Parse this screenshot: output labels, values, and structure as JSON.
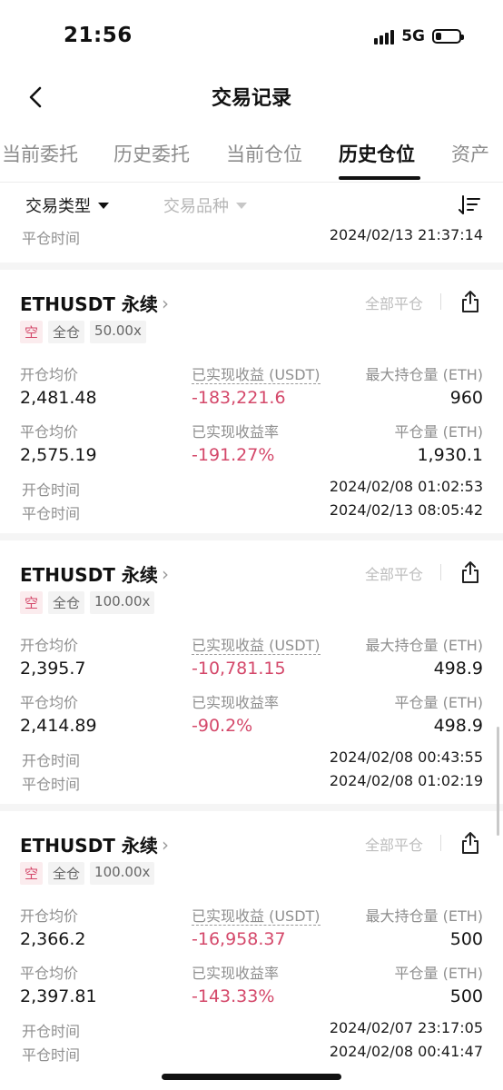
{
  "status": {
    "time": "21:56",
    "network": "5G"
  },
  "nav": {
    "title": "交易记录"
  },
  "tabs": [
    {
      "label": "当前委托"
    },
    {
      "label": "历史委托"
    },
    {
      "label": "当前仓位"
    },
    {
      "label": "历史仓位"
    },
    {
      "label": "资产"
    }
  ],
  "filters": {
    "trade_type": "交易类型",
    "trade_symbol": "交易品种"
  },
  "top_partial": {
    "close_time_label": "平仓时间",
    "close_time": "2024/02/13 21:37:14"
  },
  "cards": [
    {
      "symbol": "ETHUSDT 永续",
      "close_all": "全部平仓",
      "side": "空",
      "margin": "全仓",
      "leverage": "50.00x",
      "open_avg_label": "开仓均价",
      "open_avg": "2,481.48",
      "pnl_label": "已实现收益 (USDT)",
      "pnl": "-183,221.6",
      "max_pos_label": "最大持仓量 (ETH)",
      "max_pos": "960",
      "close_avg_label": "平仓均价",
      "close_avg": "2,575.19",
      "pnl_rate_label": "已实现收益率",
      "pnl_rate": "-191.27%",
      "close_qty_label": "平仓量 (ETH)",
      "close_qty": "1,930.1",
      "open_time_label": "开仓时间",
      "open_time": "2024/02/08 01:02:53",
      "close_time_label": "平仓时间",
      "close_time": "2024/02/13 08:05:42"
    },
    {
      "symbol": "ETHUSDT 永续",
      "close_all": "全部平仓",
      "side": "空",
      "margin": "全仓",
      "leverage": "100.00x",
      "open_avg_label": "开仓均价",
      "open_avg": "2,395.7",
      "pnl_label": "已实现收益 (USDT)",
      "pnl": "-10,781.15",
      "max_pos_label": "最大持仓量 (ETH)",
      "max_pos": "498.9",
      "close_avg_label": "平仓均价",
      "close_avg": "2,414.89",
      "pnl_rate_label": "已实现收益率",
      "pnl_rate": "-90.2%",
      "close_qty_label": "平仓量 (ETH)",
      "close_qty": "498.9",
      "open_time_label": "开仓时间",
      "open_time": "2024/02/08 00:43:55",
      "close_time_label": "平仓时间",
      "close_time": "2024/02/08 01:02:19"
    },
    {
      "symbol": "ETHUSDT 永续",
      "close_all": "全部平仓",
      "side": "空",
      "margin": "全仓",
      "leverage": "100.00x",
      "open_avg_label": "开仓均价",
      "open_avg": "2,366.2",
      "pnl_label": "已实现收益 (USDT)",
      "pnl": "-16,958.37",
      "max_pos_label": "最大持仓量 (ETH)",
      "max_pos": "500",
      "close_avg_label": "平仓均价",
      "close_avg": "2,397.81",
      "pnl_rate_label": "已实现收益率",
      "pnl_rate": "-143.33%",
      "close_qty_label": "平仓量 (ETH)",
      "close_qty": "500",
      "open_time_label": "开仓时间",
      "open_time": "2024/02/07 23:17:05",
      "close_time_label": "平仓时间",
      "close_time": "2024/02/08 00:41:47"
    }
  ],
  "colors": {
    "negative": "#d4486a",
    "muted": "#8f8f8f",
    "tab_active": "#111111"
  }
}
